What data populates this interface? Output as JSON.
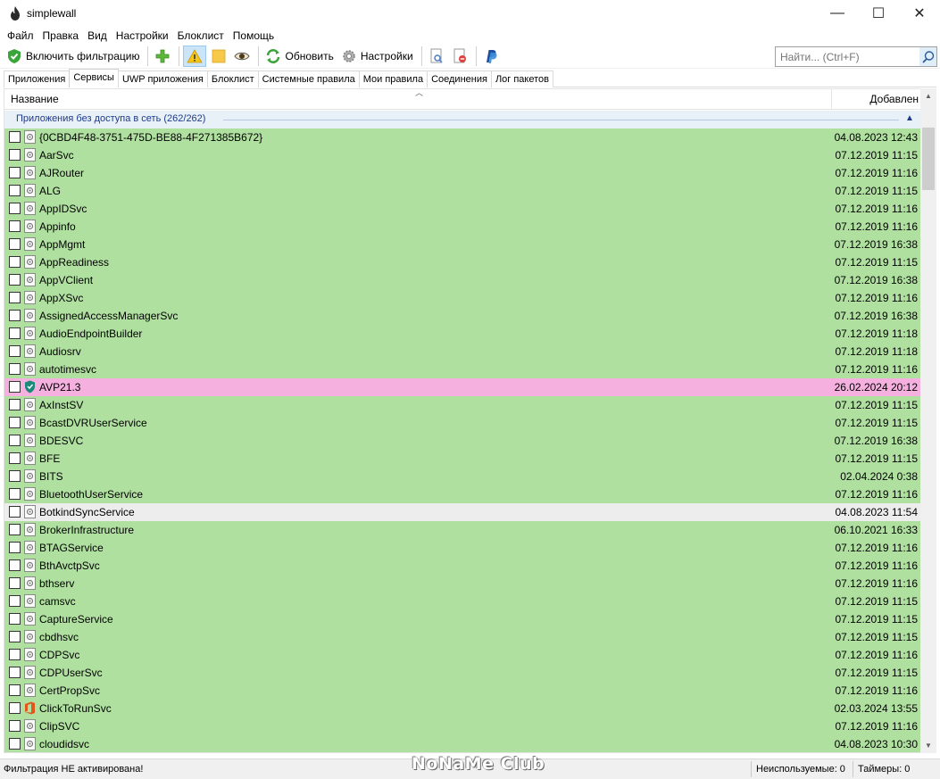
{
  "window": {
    "title": "simplewall",
    "minimize": "—",
    "maximize": "☐",
    "close": "✕"
  },
  "menu": [
    "Файл",
    "Правка",
    "Вид",
    "Настройки",
    "Блоклист",
    "Помощь"
  ],
  "toolbar": {
    "enable_filtering": "Включить фильтрацию",
    "refresh": "Обновить",
    "settings": "Настройки"
  },
  "search": {
    "placeholder": "Найти... (Ctrl+F)"
  },
  "tabs": [
    "Приложения",
    "Сервисы",
    "UWP приложения",
    "Блоклист",
    "Системные правила",
    "Мои правила",
    "Соединения",
    "Лог пакетов"
  ],
  "list": {
    "col_name": "Название",
    "col_date": "Добавлен",
    "group_title": "Приложения без доступа в сеть (262/262)",
    "rows": [
      {
        "name": "{0CBD4F48-3751-475D-BE88-4F271385B672}",
        "date": "04.08.2023 12:43",
        "color": "green",
        "icon": "service-icon"
      },
      {
        "name": "AarSvc",
        "date": "07.12.2019 11:15",
        "color": "green",
        "icon": "service-icon"
      },
      {
        "name": "AJRouter",
        "date": "07.12.2019 11:16",
        "color": "green",
        "icon": "service-icon"
      },
      {
        "name": "ALG",
        "date": "07.12.2019 11:15",
        "color": "green",
        "icon": "service-icon"
      },
      {
        "name": "AppIDSvc",
        "date": "07.12.2019 11:16",
        "color": "green",
        "icon": "service-icon"
      },
      {
        "name": "Appinfo",
        "date": "07.12.2019 11:16",
        "color": "green",
        "icon": "service-icon"
      },
      {
        "name": "AppMgmt",
        "date": "07.12.2019 16:38",
        "color": "green",
        "icon": "service-icon"
      },
      {
        "name": "AppReadiness",
        "date": "07.12.2019 11:15",
        "color": "green",
        "icon": "service-icon"
      },
      {
        "name": "AppVClient",
        "date": "07.12.2019 16:38",
        "color": "green",
        "icon": "service-icon"
      },
      {
        "name": "AppXSvc",
        "date": "07.12.2019 11:16",
        "color": "green",
        "icon": "service-icon"
      },
      {
        "name": "AssignedAccessManagerSvc",
        "date": "07.12.2019 16:38",
        "color": "green",
        "icon": "service-icon"
      },
      {
        "name": "AudioEndpointBuilder",
        "date": "07.12.2019 11:18",
        "color": "green",
        "icon": "service-icon"
      },
      {
        "name": "Audiosrv",
        "date": "07.12.2019 11:18",
        "color": "green",
        "icon": "service-icon"
      },
      {
        "name": "autotimesvc",
        "date": "07.12.2019 11:16",
        "color": "green",
        "icon": "service-icon"
      },
      {
        "name": "AVP21.3",
        "date": "26.02.2024 20:12",
        "color": "pink",
        "icon": "kaspersky-shield-icon"
      },
      {
        "name": "AxInstSV",
        "date": "07.12.2019 11:15",
        "color": "green",
        "icon": "service-icon"
      },
      {
        "name": "BcastDVRUserService",
        "date": "07.12.2019 11:15",
        "color": "green",
        "icon": "service-icon"
      },
      {
        "name": "BDESVC",
        "date": "07.12.2019 16:38",
        "color": "green",
        "icon": "service-icon"
      },
      {
        "name": "BFE",
        "date": "07.12.2019 11:15",
        "color": "green",
        "icon": "service-icon"
      },
      {
        "name": "BITS",
        "date": "02.04.2024 0:38",
        "color": "green",
        "icon": "service-icon"
      },
      {
        "name": "BluetoothUserService",
        "date": "07.12.2019 11:16",
        "color": "green",
        "icon": "service-icon"
      },
      {
        "name": "BotkindSyncService",
        "date": "04.08.2023 11:54",
        "color": "white",
        "icon": "service-icon"
      },
      {
        "name": "BrokerInfrastructure",
        "date": "06.10.2021 16:33",
        "color": "green",
        "icon": "service-icon"
      },
      {
        "name": "BTAGService",
        "date": "07.12.2019 11:16",
        "color": "green",
        "icon": "service-icon"
      },
      {
        "name": "BthAvctpSvc",
        "date": "07.12.2019 11:16",
        "color": "green",
        "icon": "service-icon"
      },
      {
        "name": "bthserv",
        "date": "07.12.2019 11:16",
        "color": "green",
        "icon": "service-icon"
      },
      {
        "name": "camsvc",
        "date": "07.12.2019 11:15",
        "color": "green",
        "icon": "service-icon"
      },
      {
        "name": "CaptureService",
        "date": "07.12.2019 11:15",
        "color": "green",
        "icon": "service-icon"
      },
      {
        "name": "cbdhsvc",
        "date": "07.12.2019 11:15",
        "color": "green",
        "icon": "service-icon"
      },
      {
        "name": "CDPSvc",
        "date": "07.12.2019 11:16",
        "color": "green",
        "icon": "service-icon"
      },
      {
        "name": "CDPUserSvc",
        "date": "07.12.2019 11:15",
        "color": "green",
        "icon": "service-icon"
      },
      {
        "name": "CertPropSvc",
        "date": "07.12.2019 11:16",
        "color": "green",
        "icon": "service-icon"
      },
      {
        "name": "ClickToRunSvc",
        "date": "02.03.2024 13:55",
        "color": "green",
        "icon": "office-icon"
      },
      {
        "name": "ClipSVC",
        "date": "07.12.2019 11:16",
        "color": "green",
        "icon": "service-icon"
      },
      {
        "name": "cloudidsvc",
        "date": "04.08.2023 10:30",
        "color": "green",
        "icon": "service-icon"
      }
    ]
  },
  "status": {
    "filter_state": "Фильтрация НЕ активирована!",
    "unused": "Неиспользуемые: 0",
    "timers": "Таймеры: 0"
  },
  "watermark": "NoNaMe Club",
  "colors": {
    "row_green": "#b0e0a0",
    "row_pink": "#f5b0e0",
    "row_white": "#ededed",
    "group_text": "#1e3a8a"
  }
}
